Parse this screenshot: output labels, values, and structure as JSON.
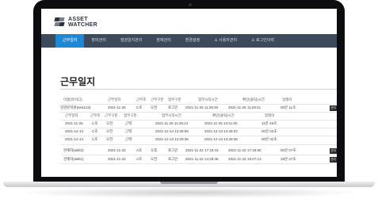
{
  "app": {
    "logo_line1": "ASSET",
    "logo_line2": "WATCHER"
  },
  "nav": {
    "items": [
      "근무일지",
      "장비관리",
      "점검일지관리",
      "장애관리",
      "환경설정",
      "사용자관리",
      "로그인이력"
    ]
  },
  "page": {
    "title": "근무일지"
  },
  "table": {
    "outer_headers": [
      "이름(아이디)",
      "근무일자",
      "근무조",
      "근무구분",
      "업무구분",
      "업무시작시간",
      "확인(클릭)시간",
      "일레이"
    ],
    "outer_rows": [
      {
        "name": "김현빈학원(test123)",
        "date": "2021-11-25",
        "team": "C조",
        "shift": "오전",
        "task": "로그인",
        "start": "2021-11-25 11:28:30",
        "confirm": "2021-11-25 11:28:41",
        "delay": "00분 11초",
        "btn": "관리"
      }
    ],
    "inner_headers": [
      "근무일자",
      "근무조",
      "근무구분",
      "업무구분",
      "업무시작시간",
      "확인(클릭)시간",
      "일레이"
    ],
    "inner_rows": [
      {
        "date": "2021-11-25",
        "team": "C조",
        "shift": "오전",
        "task": "근력",
        "start": "2021-11-25 11:29:14",
        "confirm": "2021-11-25 13:41:00",
        "delay": "11분 46초"
      },
      {
        "date": "2021-12-13",
        "team": "C조",
        "shift": "오전",
        "task": "근력",
        "start": "2021-12-13 14:28:58",
        "confirm": "2021-12-13 14:29:02",
        "delay": "00분 04초"
      },
      {
        "date": "2021-12-13",
        "team": "C조",
        "shift": "오전",
        "task": "근력",
        "start": "2021-12-13 14:29:36",
        "confirm": "2021-12-13 14:29:38",
        "delay": "00분 02초"
      }
    ],
    "more_rows": [
      {
        "name": "관계자(wklt2)",
        "date": "2021-11-22",
        "team": "A조",
        "shift": "오후",
        "task": "로그인",
        "start": "2021-11-22 17:18:43",
        "confirm": "2021-11-22 17:18:50",
        "delay": "00분 07초",
        "btn": "관리"
      },
      {
        "name": "관계자(wklt1)",
        "date": "2021-11-22",
        "team": "A조",
        "shift": "오전",
        "task": "로그인",
        "start": "2021-11-22 14:28:46",
        "confirm": "2021-11-22 15:07:13",
        "delay": "28분 27초",
        "btn": "관리"
      }
    ]
  }
}
